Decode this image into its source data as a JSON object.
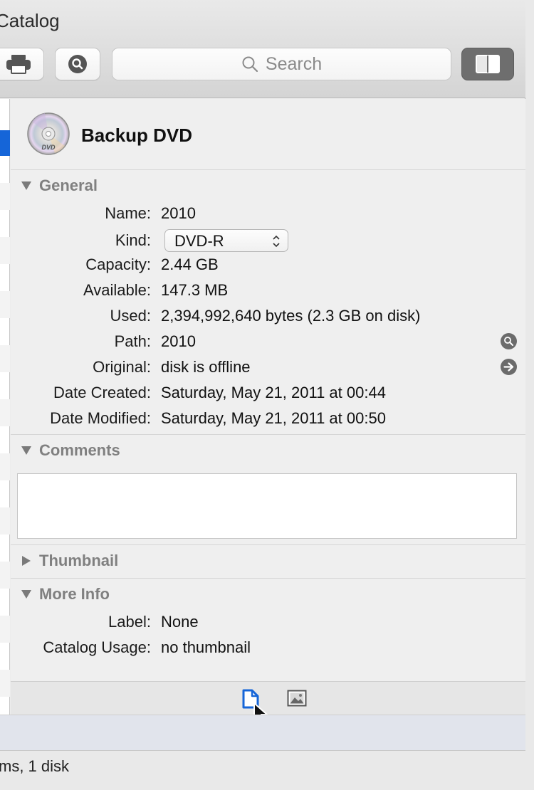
{
  "window": {
    "title": "Catalog"
  },
  "toolbar": {
    "print_icon": "printer-icon",
    "inspect_icon": "magnifier-icon",
    "search_placeholder": "Search",
    "panel_icon": "sidebar-toggle-icon"
  },
  "volume": {
    "name": "Backup DVD",
    "icon": "dvd-disc-icon"
  },
  "sections": {
    "general": "General",
    "comments": "Comments",
    "thumbnail": "Thumbnail",
    "more_info": "More Info"
  },
  "general": {
    "name_label": "Name:",
    "name_value": "2010",
    "kind_label": "Kind:",
    "kind_value": "DVD-R",
    "capacity_label": "Capacity:",
    "capacity_value": "2.44 GB",
    "available_label": "Available:",
    "available_value": "147.3 MB",
    "used_label": "Used:",
    "used_value": "2,394,992,640 bytes (2.3 GB on disk)",
    "path_label": "Path:",
    "path_value": "2010",
    "original_label": "Original:",
    "original_value": "disk is offline",
    "created_label": "Date Created:",
    "created_value": "Saturday, May 21, 2011 at 00:44",
    "modified_label": "Date Modified:",
    "modified_value": "Saturday, May 21, 2011 at 00:50"
  },
  "more_info": {
    "label_label": "Label:",
    "label_value": "None",
    "usage_label": "Catalog Usage:",
    "usage_value": "no thumbnail"
  },
  "comments": {
    "value": ""
  },
  "status": {
    "text": "ms, 1 disk"
  },
  "colors": {
    "accent": "#1565d8",
    "section_text": "#808080"
  }
}
